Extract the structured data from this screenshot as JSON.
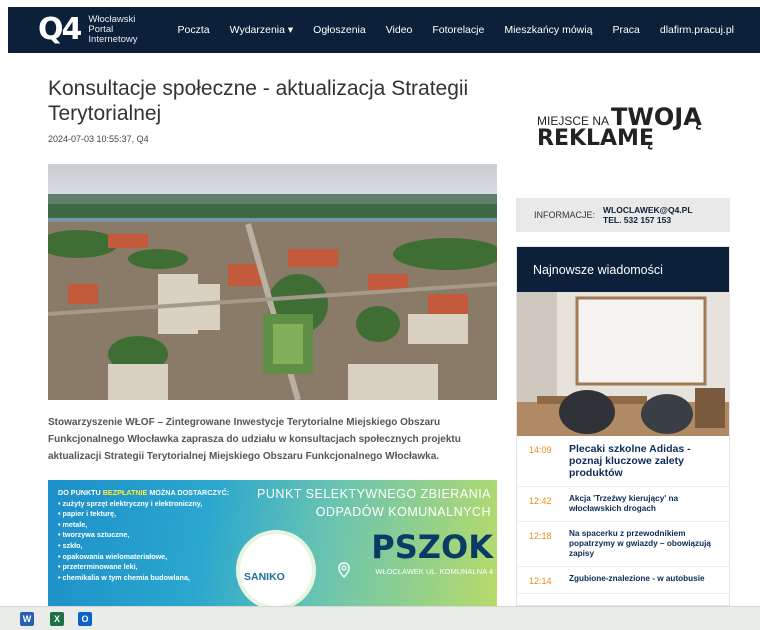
{
  "nav": {
    "logo_mark": "Q4",
    "logo_lines": [
      "Włocławski",
      "Portal",
      "Internetowy"
    ],
    "menu": [
      "Poczta",
      "Wydarzenia ▾",
      "Ogłoszenia",
      "Video",
      "Fotorelacje",
      "Mieszkańcy mówią",
      "Praca",
      "dlafirm.pracuj.pl"
    ]
  },
  "article": {
    "title": "Konsultacje społeczne - aktualizacja Strategii Terytorialnej",
    "meta": "2024-07-03 10:55:37, Q4",
    "lead": "Stowarzyszenie WŁOF – Zintegrowane Inwestycje Terytorialne Miejskiego Obszaru Funkcjonalnego Włocławka zaprasza do udziału w konsultacjach społecznych projektu aktualizacji Strategii Terytorialnej Miejskiego Obszaru Funkcjonalnego Włocławka."
  },
  "banner": {
    "intro_pre": "DO PUNKTU ",
    "intro_hl": "BEZPŁATNIE",
    "intro_post": " MOŻNA DOSTARCZYĆ:",
    "items": [
      "• zużyty sprzęt elektryczny i elektroniczny,",
      "• papier i tekturę,",
      "• metale,",
      "• tworzywa sztuczne,",
      "• szkło,",
      "• opakowania wielomateriałowe,",
      "• przeterminowane leki,",
      "• chemikalia w tym chemia budowlana,"
    ],
    "title_line1": "PUNKT SELEKTYWNEGO ZBIERANIA",
    "title_line2": "ODPADÓW KOMUNALNYCH",
    "brand": "PSZOK",
    "address": "WŁOCŁAWEK UL. KOMUNALNA 4",
    "logo": "SANIKO"
  },
  "sidebar": {
    "ad_line1_small": "MIEJSCE NA",
    "ad_line1_big": "TWOJĄ",
    "ad_line2": "REKLAMĘ",
    "info_label": "INFORMACJE:",
    "info_email": "WLOCLAWEK@Q4.PL",
    "info_tel": "TEL.  532 157 153",
    "news_title": "Najnowsze wiadomości",
    "news": [
      {
        "time": "14:09",
        "text": "Plecaki szkolne Adidas - poznaj kluczowe zalety produktów"
      },
      {
        "time": "12:42",
        "text": "Akcja 'Trzeźwy kierujący' na włocławskich drogach"
      },
      {
        "time": "12:18",
        "text": "Na spacerku z przewodnikiem popatrzymy w gwiazdy – obowiązują zapisy"
      },
      {
        "time": "12:14",
        "text": "Zgubione-znalezione - w autobusie"
      }
    ]
  },
  "taskbar": {
    "apps": [
      "word-icon",
      "excel-icon",
      "outlook-icon"
    ],
    "colors": {
      "word": "#2b5fb4",
      "excel": "#1e7145",
      "outlook": "#0a64c8"
    }
  },
  "colors": {
    "nav_bg": "#0d2039",
    "accent_time": "#f08a1c",
    "news_link": "#0d2b59"
  }
}
